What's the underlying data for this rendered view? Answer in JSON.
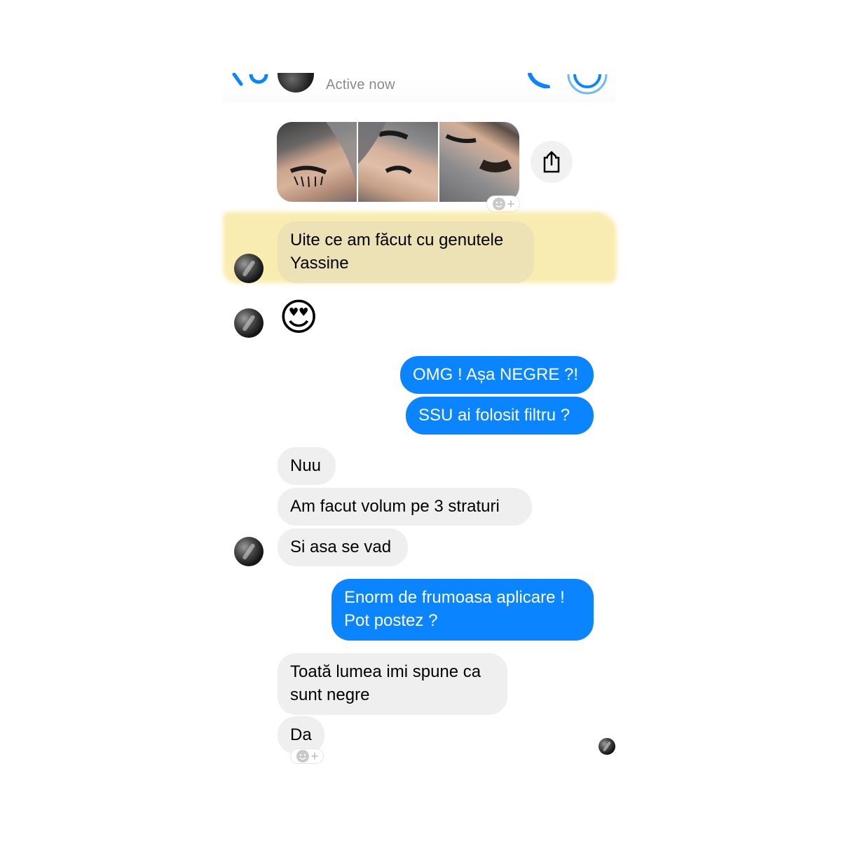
{
  "header": {
    "status": "Active now"
  },
  "colors": {
    "accent": "#0a84ff",
    "incoming_bubble": "#efefef",
    "highlight": "#f7e79a"
  },
  "icons": {
    "back": "chevron-left-icon",
    "phone": "phone-icon",
    "video": "video-icon",
    "share": "share-icon",
    "reaction": "add-reaction-icon"
  },
  "messages": {
    "m1_line1": "Uite ce am făcut cu genutele",
    "m1_line2": "Yassine",
    "m2_emoji": "😍",
    "m3": "OMG ! Așa NEGRE ?!",
    "m4": "SSU ai folosit filtru ?",
    "m5": "Nuu",
    "m6": "Am facut volum pe 3 straturi",
    "m7": "Si asa se vad",
    "m8_line1": "Enorm de frumoasa aplicare !",
    "m8_line2": "Pot postez ?",
    "m9_line1": "Toată lumea imi spune ca",
    "m9_line2": "sunt negre",
    "m10": "Da"
  }
}
